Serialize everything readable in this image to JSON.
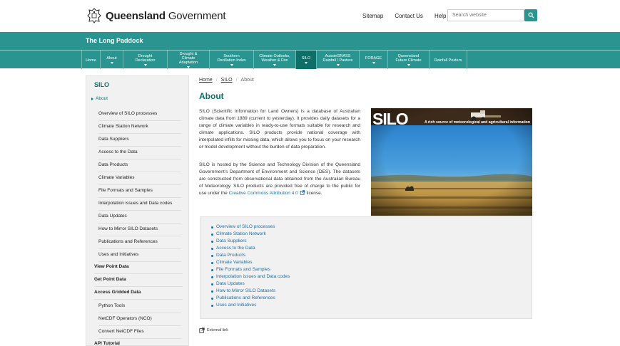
{
  "header": {
    "brand_bold": "Queensland",
    "brand_rest": " Government",
    "links": [
      "Sitemap",
      "Contact Us",
      "Help"
    ],
    "search_placeholder": "Search website",
    "site_title": "The Long Paddock"
  },
  "nav": {
    "tabs": [
      {
        "label": "Home",
        "caret": false
      },
      {
        "label": "About",
        "caret": true
      },
      {
        "label": "Drought Declaration",
        "caret": true
      },
      {
        "label": "Drought & Climate Adaptation",
        "caret": true
      },
      {
        "label": "Southern Oscillation Index",
        "caret": true
      },
      {
        "label": "Climate Outlooks, Weather & Fire",
        "caret": true
      },
      {
        "label": "SILO",
        "caret": true
      },
      {
        "label": "AussieGRASS Rainfall / Pasture",
        "caret": true
      },
      {
        "label": "FORAGE",
        "caret": true
      },
      {
        "label": "Queensland Future Climate",
        "caret": true
      },
      {
        "label": "Rainfall Posters",
        "caret": false
      }
    ]
  },
  "sidebar": {
    "title": "SILO",
    "current": "About",
    "sub_items": [
      "Overview of SILO processes",
      "Climate Station Network",
      "Data Suppliers",
      "Access to the Data",
      "Data Products",
      "Climate Variables",
      "File Formats and Samples",
      "Interpolation issues and Data codes",
      "Data Updates",
      "How to Mirror SILO Datasets",
      "Publications and References",
      "Uses and Initiatives"
    ],
    "main_items_a": [
      "View Point Data",
      "Get Point Data",
      "Access Gridded Data"
    ],
    "gridded_sub": [
      "Python Tools",
      "NetCDF Operators (NCO)",
      "Convert NetCDF Files"
    ],
    "main_items_b": [
      "API Tutorial"
    ]
  },
  "breadcrumb": [
    "Home",
    "SILO",
    "About"
  ],
  "main": {
    "title": "About",
    "p1": "SILO (Scientific Information for Land Owners) is a database of Australian climate data from 1889 (current to yesterday). It provides daily datasets for a range of climate variables in ready-to-use formats suitable for research and climate applications. SILO products provide national coverage with interpolated infills for missing data, which allows you to focus on your research or model development without the burden of data preparation.",
    "p2_before": "SILO is hosted by the Science and Technology Division of the Queensland Government’s Department of Environment and Science (DES). The datasets are constructed from observational data obtained from the Australian Bureau of Meteorology. SILO products are provided free of charge to the public for use under the ",
    "p2_link": "Creative Commons Attribution 4.0",
    "p2_after": " license.",
    "hero_logo": "SILO",
    "hero_tagline": "A rich source of meteorological and agricultural information",
    "toc": [
      "Overview of SILO processes",
      "Climate Station Network",
      "Data Suppliers",
      "Access to the Data",
      "Data Products",
      "Climate Variables",
      "File Formats and Samples",
      "Interpolation issues and Data codes",
      "Data Updates",
      "How to Mirror SILO Datasets",
      "Publications and References",
      "Uses and Initiatives"
    ],
    "external_link_note": "External link"
  },
  "colors": {
    "teal": "#2a9590",
    "teal_dark": "#0e6f68",
    "link": "#1a6fa6"
  }
}
